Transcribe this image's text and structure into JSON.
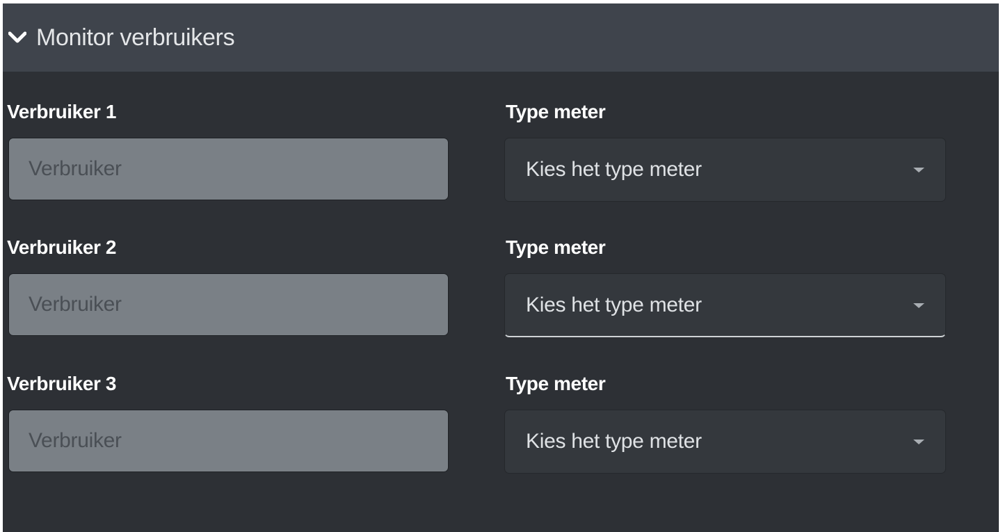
{
  "panel": {
    "title": "Monitor verbruikers",
    "chevron_icon": "chevron-down-icon"
  },
  "consumers": [
    {
      "label": "Verbruiker 1",
      "input_placeholder": "Verbruiker",
      "type_label": "Type meter",
      "select_value": "Kies het type meter"
    },
    {
      "label": "Verbruiker 2",
      "input_placeholder": "Verbruiker",
      "type_label": "Type meter",
      "select_value": "Kies het type meter"
    },
    {
      "label": "Verbruiker 3",
      "input_placeholder": "Verbruiker",
      "type_label": "Type meter",
      "select_value": "Kies het type meter"
    }
  ],
  "colors": {
    "panel_bg": "#2d3035",
    "header_bg": "#3f444c",
    "input_bg": "#7a8086",
    "select_bg": "#34383d"
  }
}
